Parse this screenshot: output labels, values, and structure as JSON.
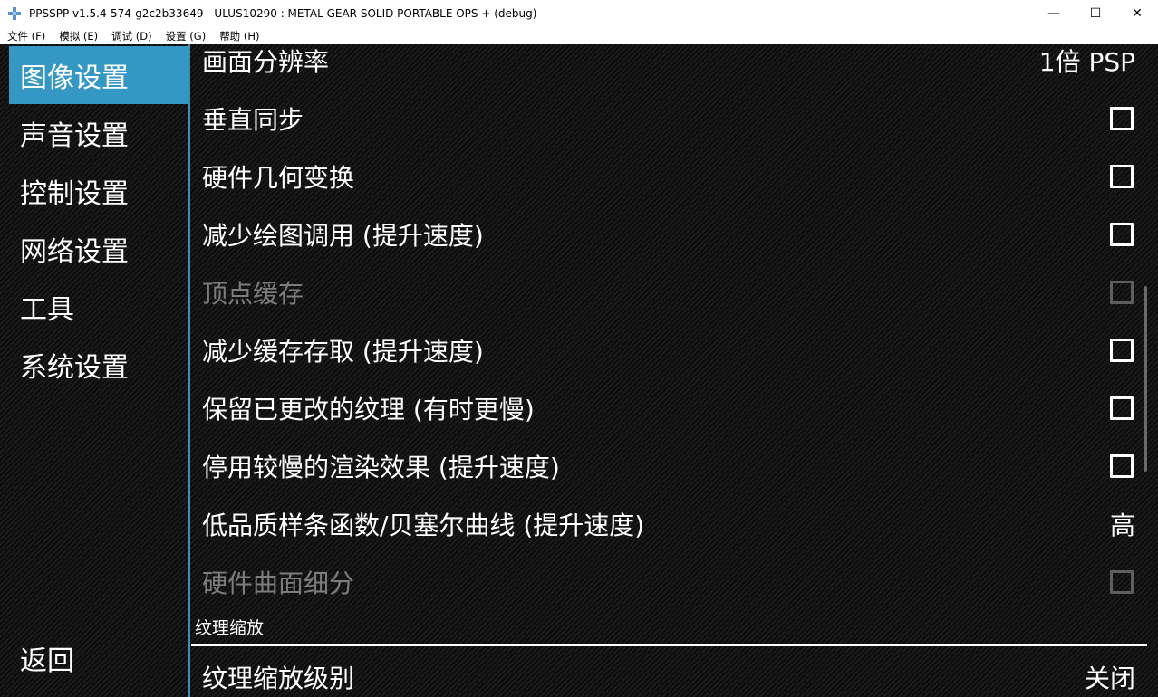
{
  "window": {
    "title": "PPSSPP v1.5.4-574-g2c2b33649 - ULUS10290 : METAL GEAR SOLID PORTABLE OPS + (debug)",
    "icon": "ppsspp-app-icon",
    "controls": {
      "minimize": "—",
      "maximize": "☐",
      "close": "✕"
    }
  },
  "menu": [
    "文件 (F)",
    "模拟 (E)",
    "调试 (D)",
    "设置 (G)",
    "帮助 (H)"
  ],
  "sidebar": {
    "tabs": [
      {
        "label": "图像设置",
        "active": true
      },
      {
        "label": "声音设置",
        "active": false
      },
      {
        "label": "控制设置",
        "active": false
      },
      {
        "label": "网络设置",
        "active": false
      },
      {
        "label": "工具",
        "active": false
      },
      {
        "label": "系统设置",
        "active": false
      }
    ],
    "back_label": "返回"
  },
  "settings": [
    {
      "label": "画面分辨率",
      "type": "value",
      "value": "1倍 PSP",
      "enabled": true
    },
    {
      "label": "垂直同步",
      "type": "checkbox",
      "checked": false,
      "enabled": true
    },
    {
      "label": "硬件几何变换",
      "type": "checkbox",
      "checked": false,
      "enabled": true
    },
    {
      "label": "减少绘图调用 (提升速度)",
      "type": "checkbox",
      "checked": false,
      "enabled": true
    },
    {
      "label": "顶点缓存",
      "type": "checkbox",
      "checked": false,
      "enabled": false
    },
    {
      "label": "减少缓存存取 (提升速度)",
      "type": "checkbox",
      "checked": false,
      "enabled": true
    },
    {
      "label": "保留已更改的纹理 (有时更慢)",
      "type": "checkbox",
      "checked": false,
      "enabled": true
    },
    {
      "label": "停用较慢的渲染效果 (提升速度)",
      "type": "checkbox",
      "checked": false,
      "enabled": true
    },
    {
      "label": "低品质样条函数/贝塞尔曲线 (提升速度)",
      "type": "value",
      "value": "高",
      "enabled": true
    },
    {
      "label": "硬件曲面细分",
      "type": "checkbox",
      "checked": false,
      "enabled": false
    }
  ],
  "section": {
    "header": "纹理缩放"
  },
  "section_settings": [
    {
      "label": "纹理缩放级别",
      "type": "value",
      "value": "关闭",
      "enabled": true
    }
  ],
  "colors": {
    "accent": "#3597c4",
    "text": "#ffffff",
    "disabled_text": "#7d7d7d"
  }
}
